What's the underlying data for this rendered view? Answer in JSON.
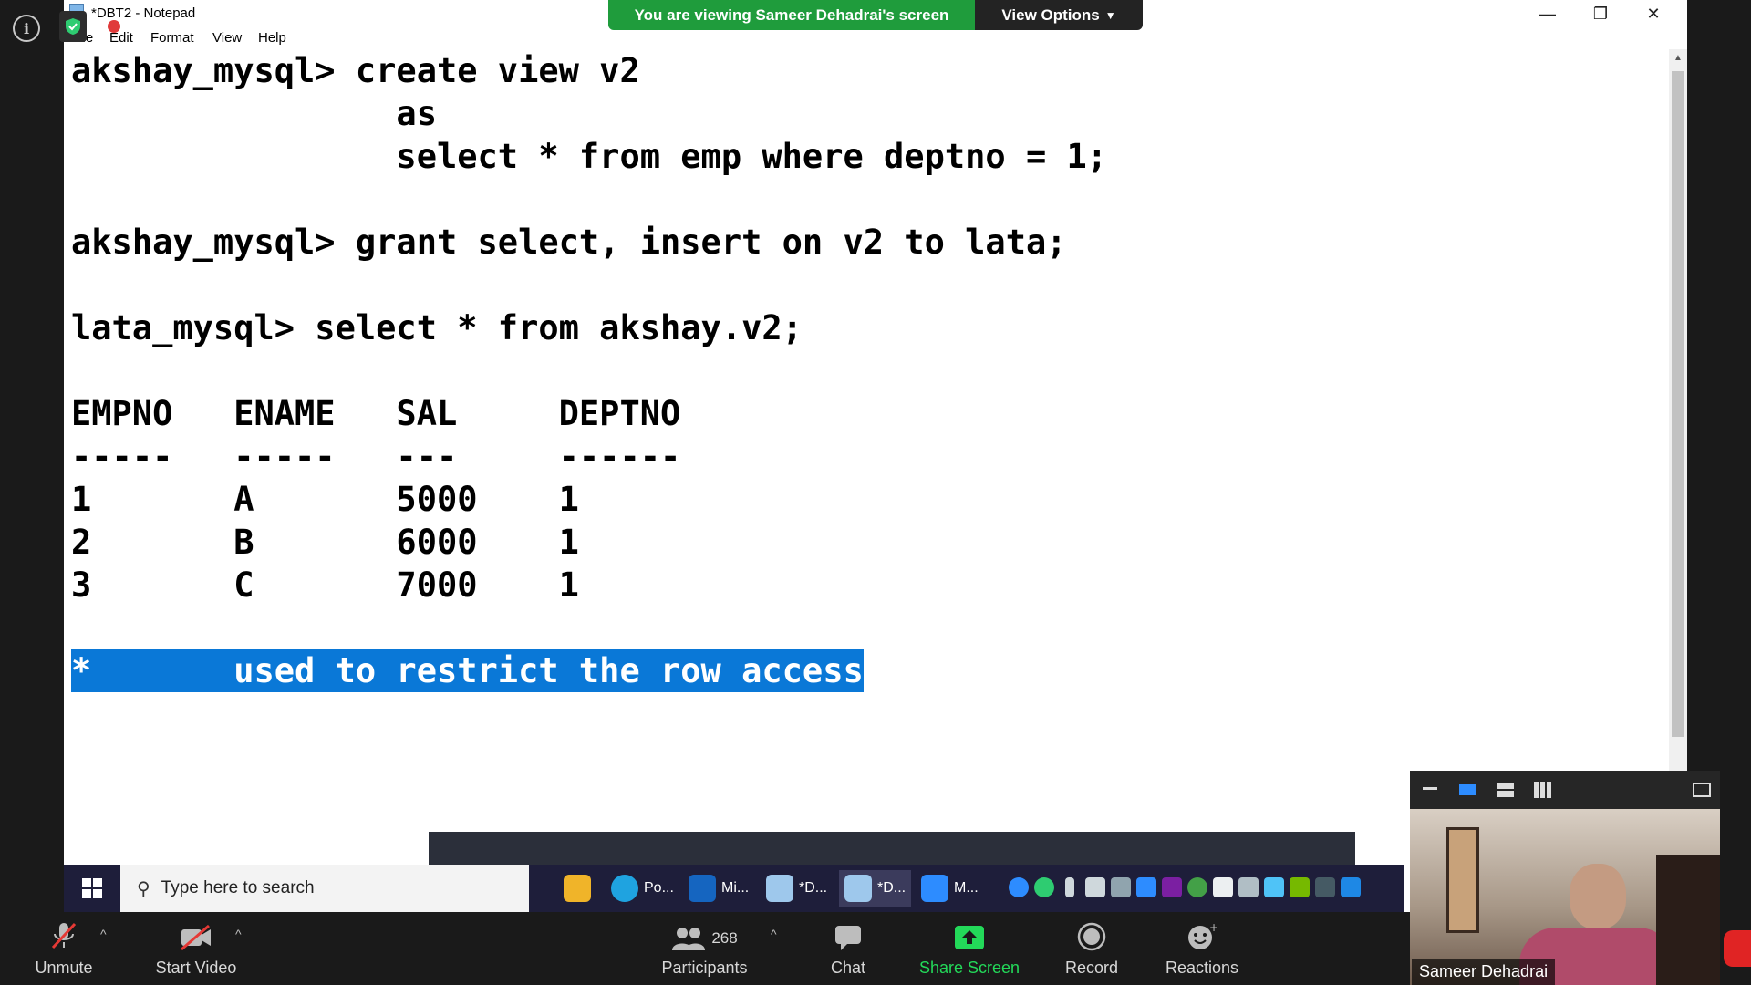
{
  "window": {
    "title": "*DBT2 - Notepad"
  },
  "menu": [
    "File",
    "Edit",
    "Format",
    "View",
    "Help"
  ],
  "banner": {
    "text": "You are viewing Sameer Dehadrai's screen",
    "view_options": "View Options"
  },
  "editor_lines": [
    "akshay_mysql> create view v2",
    "                as",
    "                select * from emp where deptno = 1;",
    "",
    "akshay_mysql> grant select, insert on v2 to lata;",
    "",
    "lata_mysql> select * from akshay.v2;",
    "",
    "EMPNO   ENAME   SAL     DEPTNO",
    "-----   -----   ---     ------",
    "1       A       5000    1",
    "2       B       6000    1",
    "3       C       7000    1",
    "",
    "*       used to restrict the row access"
  ],
  "taskbar": {
    "search_placeholder": "Type here to search",
    "apps": [
      "Po...",
      "Mi...",
      "*D...",
      "*D...",
      "M..."
    ]
  },
  "zoom": {
    "unmute": "Unmute",
    "start_video": "Start Video",
    "participants": "Participants",
    "participant_count": "268",
    "chat": "Chat",
    "share_screen": "Share Screen",
    "record": "Record",
    "reactions": "Reactions"
  },
  "video": {
    "name": "Sameer Dehadrai"
  },
  "colors": {
    "banner_green": "#1f9c3c",
    "highlight_blue": "#0a78d7",
    "share_green": "#23d959"
  }
}
